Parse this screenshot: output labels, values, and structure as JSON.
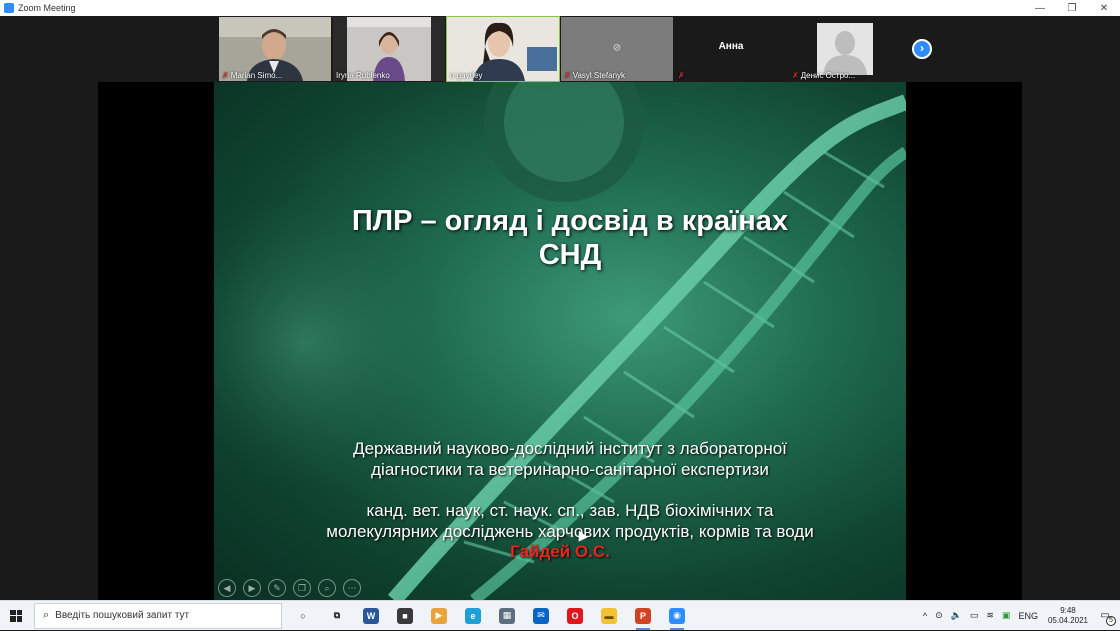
{
  "window": {
    "title": "Zoom Meeting",
    "controls": {
      "minimize": "—",
      "restore": "❐",
      "close": "✕"
    }
  },
  "participants": [
    {
      "name": "Marian Simo...",
      "muted": true,
      "video": true
    },
    {
      "name": "Iryna Rublenko",
      "muted": false,
      "video": true
    },
    {
      "name": "o gaydey",
      "muted": false,
      "video": true,
      "active_speaker": true
    },
    {
      "name": "Vasyl Stefanyk",
      "muted": true,
      "video": false
    },
    {
      "name": "Анна",
      "muted": true,
      "video": false
    },
    {
      "name": "Денис Остро...",
      "muted": true,
      "video": true
    }
  ],
  "participant_strip": {
    "next_label": "›"
  },
  "slide": {
    "title_line1": "ПЛР – огляд і досвід в країнах",
    "title_line2": "СНД",
    "institute_line1": "Державний науково-дослідний інститут з лабораторної",
    "institute_line2": "діагностики та ветеринарно-санітарної експертизи",
    "position_line1": "канд. вет. наук, ст. наук. сп., зав. НДВ біохімічних та",
    "position_line2": "молекулярних досліджень харчових продуктів, кормів та води",
    "author": "Гайдей О.С.",
    "tools": [
      "◀",
      "▶",
      "✎",
      "❐",
      "⌕",
      "⋯"
    ]
  },
  "taskbar": {
    "search_placeholder": "Введіть пошуковий запит тут",
    "apps": [
      {
        "name": "cortana",
        "glyph": "○",
        "color": "#f0f3f7",
        "fg": "#222"
      },
      {
        "name": "task-view",
        "glyph": "⧉",
        "color": "#f0f3f7",
        "fg": "#222"
      },
      {
        "name": "word",
        "glyph": "W",
        "color": "#2b579a",
        "fg": "#fff"
      },
      {
        "name": "store",
        "glyph": "■",
        "color": "#3a3a3a",
        "fg": "#fff"
      },
      {
        "name": "media-player",
        "glyph": "▶",
        "color": "#e8a33a",
        "fg": "#fff"
      },
      {
        "name": "edge",
        "glyph": "e",
        "color": "#1f9fd6",
        "fg": "#fff"
      },
      {
        "name": "calculator",
        "glyph": "▦",
        "color": "#5c6d7e",
        "fg": "#fff"
      },
      {
        "name": "mail",
        "glyph": "✉",
        "color": "#0a64c8",
        "fg": "#fff"
      },
      {
        "name": "opera",
        "glyph": "O",
        "color": "#e0161c",
        "fg": "#fff"
      },
      {
        "name": "file-explorer",
        "glyph": "▬",
        "color": "#f2c230",
        "fg": "#6b4b00"
      },
      {
        "name": "powerpoint",
        "glyph": "P",
        "color": "#d04423",
        "fg": "#fff",
        "running": true
      },
      {
        "name": "zoom",
        "glyph": "◉",
        "color": "#2d8cff",
        "fg": "#fff",
        "running": true
      }
    ],
    "tray": {
      "chevron": "^",
      "lang": "ENG",
      "time": "9:48",
      "date": "05.04.2021",
      "notifications": "5"
    }
  }
}
